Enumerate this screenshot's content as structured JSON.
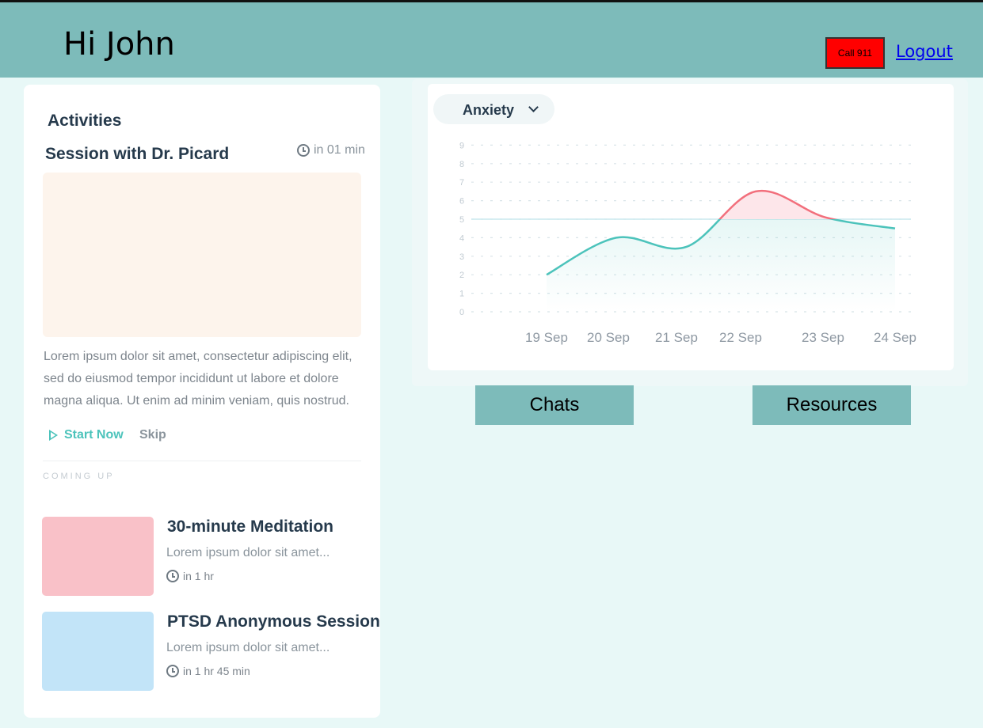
{
  "header": {
    "greeting": "Hi John",
    "call_label": "Call 911",
    "logout_label": "Logout",
    "background_color": "#7dbbba",
    "call_color": "#ff0000"
  },
  "activities": {
    "title": "Activities",
    "session": {
      "title": "Session with Dr. Picard",
      "time": "in 01 min",
      "description": "Lorem ipsum dolor sit amet, consectetur adipiscing elit, sed do eiusmod tempor incididunt ut labore et dolore magna aliqua. Ut enim ad minim veniam, quis nostrud.",
      "start_label": "Start Now",
      "skip_label": "Skip",
      "icon": "clock-icon",
      "image_color": "#fdf4ec"
    },
    "coming_up_label": "COMING UP",
    "upcoming": [
      {
        "title": "30-minute Meditation",
        "description": "Lorem ipsum dolor sit amet...",
        "time": "in 1 hr",
        "thumb_color": "#f9c1c8"
      },
      {
        "title": "PTSD Anonymous Session",
        "description": "Lorem ipsum dolor sit amet...",
        "time": "in 1 hr 45 min",
        "thumb_color": "#c2e4f8"
      }
    ]
  },
  "chart_selector": {
    "selected": "Anxiety"
  },
  "chart_data": {
    "type": "line",
    "x": [
      "19 Sep",
      "20 Sep",
      "21 Sep",
      "22 Sep",
      "23 Sep",
      "24 Sep"
    ],
    "series": [
      {
        "name": "Anxiety",
        "values": [
          2,
          4,
          3.5,
          6.5,
          5.1,
          4.5
        ]
      }
    ],
    "yticks": [
      0,
      1,
      2,
      3,
      4,
      5,
      6,
      7,
      8,
      9
    ],
    "ylim": [
      0,
      9
    ],
    "baseline": 5,
    "grid": true,
    "colors": {
      "line": "#4cc3bb",
      "above_baseline": "#f26f7c",
      "baseline": "#c9e8ee"
    }
  },
  "nav": {
    "chats_label": "Chats",
    "resources_label": "Resources",
    "button_color": "#7dbbba"
  }
}
